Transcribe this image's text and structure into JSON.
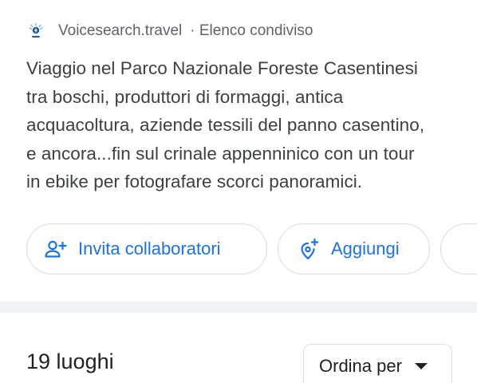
{
  "header": {
    "site": "Voicesearch.travel",
    "shared": "· Elenco condiviso",
    "logo_icon": "voicesearch-logo"
  },
  "description": {
    "lines": [
      "Viaggio nel Parco Nazionale Foreste Casentinesi",
      "tra boschi, produttori di formaggi, antica",
      "acquacoltura, aziende tessili del panno casentino,",
      "e ancora...fin sul crinale appenninico con un tour",
      "in ebike per fotografare scorci panoramici."
    ]
  },
  "actions": {
    "invite_label": "Invita collaboratori",
    "invite_icon": "person-add-icon",
    "add_label": "Aggiungi",
    "add_icon": "add-location-icon"
  },
  "places": {
    "count_label": "19 luoghi",
    "sort_label": "Ordina per",
    "sort_icon": "caret-down-icon"
  },
  "colors": {
    "accent": "#1a73e8",
    "secondary_text": "#5f6368",
    "border": "#dadce0",
    "divider": "#f1f3f4"
  }
}
